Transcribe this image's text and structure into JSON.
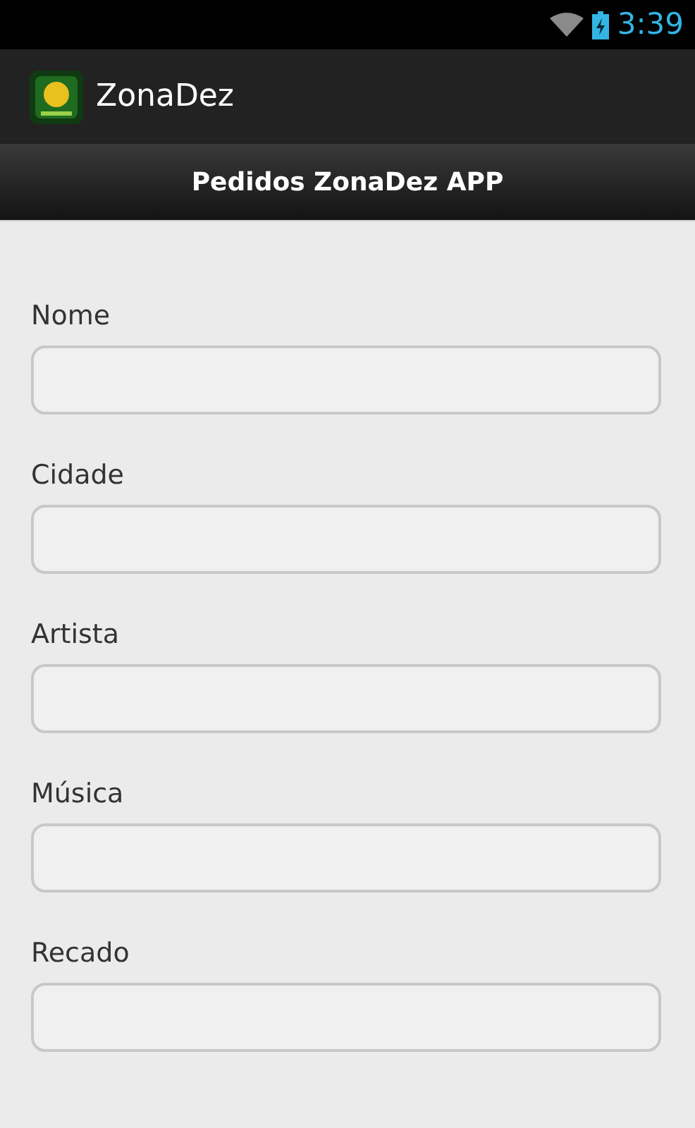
{
  "status_bar": {
    "time": "3:39"
  },
  "action_bar": {
    "title": "ZonaDez"
  },
  "header": {
    "title": "Pedidos ZonaDez APP"
  },
  "form": {
    "fields": [
      {
        "label": "Nome"
      },
      {
        "label": "Cidade"
      },
      {
        "label": "Artista"
      },
      {
        "label": "Música"
      },
      {
        "label": "Recado"
      }
    ]
  }
}
